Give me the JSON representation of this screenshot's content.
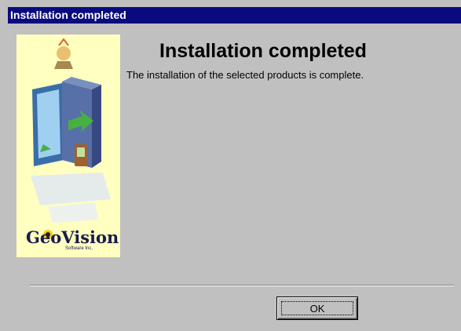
{
  "window": {
    "title": "Installation completed"
  },
  "content": {
    "heading": "Installation completed",
    "message": "The installation of the selected products is complete."
  },
  "banner": {
    "logo_text": "GeoVision",
    "logo_sub": "Software Inc."
  },
  "buttons": {
    "ok_label": "OK"
  }
}
